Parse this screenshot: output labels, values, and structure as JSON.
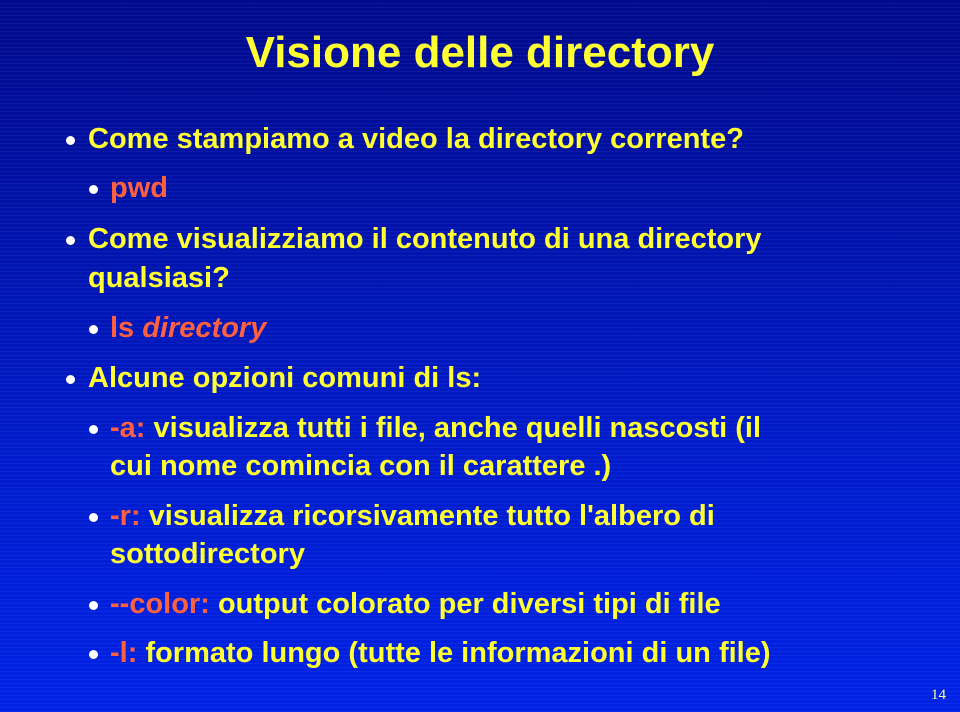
{
  "slide": {
    "title": "Visione delle directory",
    "items": [
      {
        "level": 1,
        "lines": [
          "Come stampiamo a video la directory corrente?"
        ]
      },
      {
        "level": 2,
        "command": "pwd"
      },
      {
        "level": 1,
        "lines": [
          "Come visualizziamo il contenuto di una directory",
          "qualsiasi?"
        ]
      },
      {
        "level": 2,
        "command": "ls",
        "argument": "directory"
      },
      {
        "level": 1,
        "lines": [
          "Alcune opzioni comuni di ls:"
        ]
      },
      {
        "level": 2,
        "option": "-a:",
        "lines": [
          "visualizza tutti i file, anche quelli nascosti (il",
          "cui nome comincia con il carattere .)"
        ]
      },
      {
        "level": 2,
        "option": "-r:",
        "lines": [
          "visualizza ricorsivamente tutto l'albero di",
          "sottodirectory"
        ]
      },
      {
        "level": 2,
        "option": "--color:",
        "lines": [
          "output colorato per diversi tipi di file"
        ]
      },
      {
        "level": 2,
        "option": "-l:",
        "lines": [
          "formato lungo (tutte le informazioni di un file)"
        ]
      }
    ],
    "page_number": "14"
  },
  "colors": {
    "text": "#ffff33",
    "highlight": "#ff6040",
    "bullet": "#ffffff",
    "background_top": "#000a8a",
    "background_bottom": "#0022e6"
  }
}
